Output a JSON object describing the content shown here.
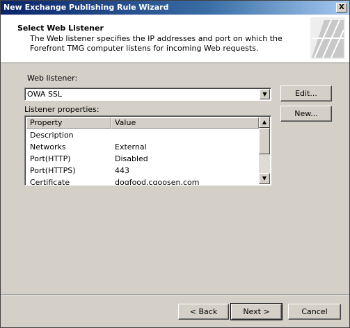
{
  "window": {
    "title": "New Exchange Publishing Rule Wizard",
    "close_glyph": "X"
  },
  "header": {
    "title": "Select Web Listener",
    "description": "The Web listener specifies the IP addresses and port on which the Forefront TMG computer listens for incoming Web requests."
  },
  "listener": {
    "label": "Web listener:",
    "selected": "OWA SSL",
    "edit_label": "Edit...",
    "new_label": "New..."
  },
  "properties": {
    "label": "Listener properties:",
    "columns": [
      "Property",
      "Value"
    ],
    "rows": [
      {
        "property": "Description",
        "value": ""
      },
      {
        "property": "Networks",
        "value": "External"
      },
      {
        "property": "Port(HTTP)",
        "value": "Disabled"
      },
      {
        "property": "Port(HTTPS)",
        "value": "443"
      },
      {
        "property": "Certificate",
        "value": "dogfood.cgoosen.com"
      }
    ]
  },
  "footer": {
    "back_label": "< Back",
    "next_label": "Next >",
    "cancel_label": "Cancel"
  },
  "colors": {
    "title_bar": "#0a246a",
    "dialog_bg": "#d4d0c8"
  }
}
